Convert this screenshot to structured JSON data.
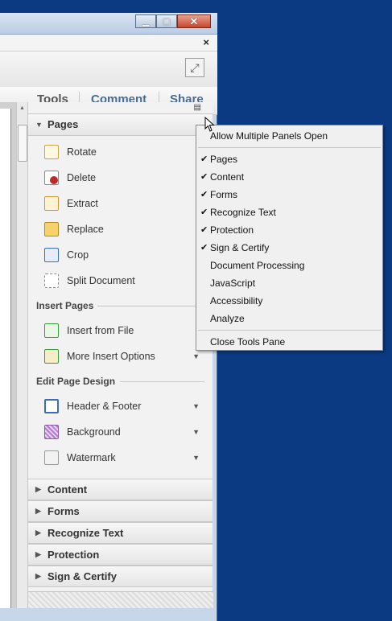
{
  "window": {
    "controls": {
      "minimize": "minimize-icon",
      "maximize": "maximize-icon",
      "close": "close-icon"
    },
    "doc_close": "×"
  },
  "tabs": {
    "tools": "Tools",
    "comment": "Comment",
    "share": "Share"
  },
  "pane": {
    "pages": {
      "title": "Pages",
      "items": [
        {
          "label": "Rotate",
          "icon": "rotate-icon"
        },
        {
          "label": "Delete",
          "icon": "delete-icon"
        },
        {
          "label": "Extract",
          "icon": "extract-icon"
        },
        {
          "label": "Replace",
          "icon": "replace-icon"
        },
        {
          "label": "Crop",
          "icon": "crop-icon"
        },
        {
          "label": "Split Document",
          "icon": "split-document-icon"
        }
      ],
      "insert_title": "Insert Pages",
      "insert_items": [
        {
          "label": "Insert from File",
          "icon": "insert-file-icon"
        },
        {
          "label": "More Insert Options",
          "icon": "more-insert-icon"
        }
      ],
      "edit_title": "Edit Page Design",
      "edit_items": [
        {
          "label": "Header & Footer",
          "icon": "header-footer-icon"
        },
        {
          "label": "Background",
          "icon": "background-icon"
        },
        {
          "label": "Watermark",
          "icon": "watermark-icon"
        }
      ]
    },
    "collapsed": [
      "Content",
      "Forms",
      "Recognize Text",
      "Protection",
      "Sign & Certify"
    ]
  },
  "menu": {
    "top": "Allow Multiple Panels Open",
    "items": [
      {
        "label": "Pages",
        "checked": true
      },
      {
        "label": "Content",
        "checked": true
      },
      {
        "label": "Forms",
        "checked": true
      },
      {
        "label": "Recognize Text",
        "checked": true
      },
      {
        "label": "Protection",
        "checked": true
      },
      {
        "label": "Sign & Certify",
        "checked": true
      },
      {
        "label": "Document Processing",
        "checked": false
      },
      {
        "label": "JavaScript",
        "checked": false
      },
      {
        "label": "Accessibility",
        "checked": false
      },
      {
        "label": "Analyze",
        "checked": false
      }
    ],
    "bottom": "Close Tools Pane",
    "check_glyph": "✔"
  }
}
